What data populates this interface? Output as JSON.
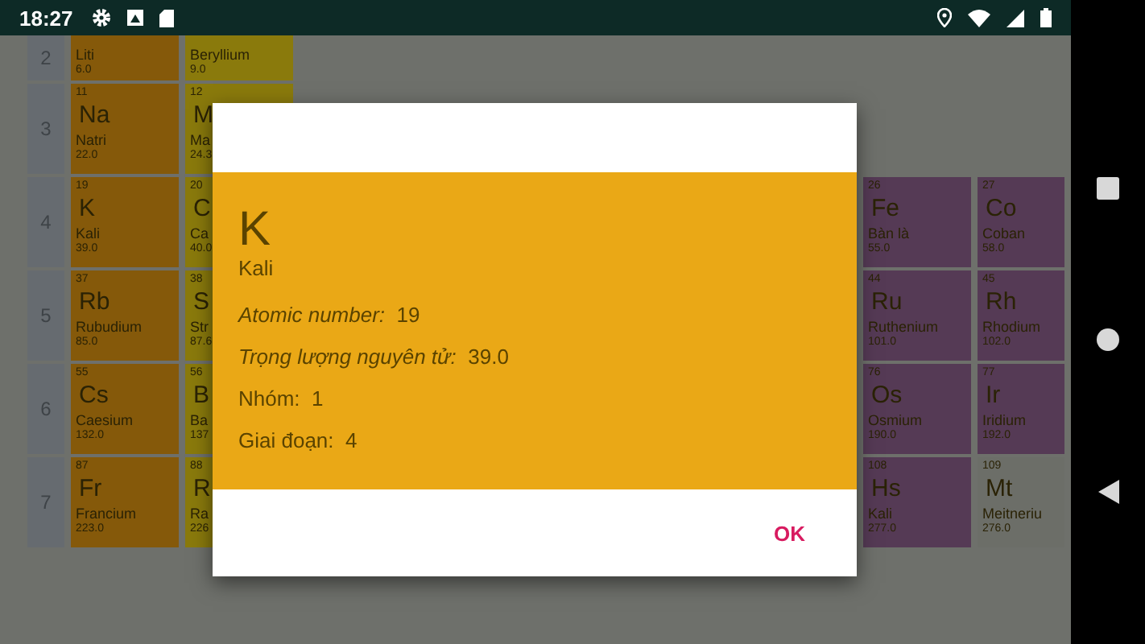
{
  "status_bar": {
    "time": "18:27"
  },
  "periodic_table": {
    "rows": [
      {
        "period": "2",
        "left": [
          {
            "name": "Liti",
            "weight": "6.0",
            "color": "#85590a"
          },
          {
            "name": "Beryllium",
            "weight": "9.0",
            "color": "#8a7a0c"
          }
        ],
        "right": []
      },
      {
        "period": "3",
        "left": [
          {
            "number": "11",
            "symbol": "Na",
            "name": "Natri",
            "weight": "22.0",
            "color": "#85590a"
          },
          {
            "number": "12",
            "symbol": "M",
            "name": "Ma",
            "weight": "24.3",
            "color": "#8a7a0c"
          }
        ],
        "right": []
      },
      {
        "period": "4",
        "left": [
          {
            "number": "19",
            "symbol": "K",
            "name": "Kali",
            "weight": "39.0",
            "color": "#85590a"
          },
          {
            "number": "20",
            "symbol": "C",
            "name": "Ca",
            "weight": "40.0",
            "color": "#8a7a0c"
          }
        ],
        "right": [
          {
            "number": "26",
            "symbol": "Fe",
            "name": "Bàn là",
            "weight": "55.0",
            "color": "#553a55"
          },
          {
            "number": "27",
            "symbol": "Co",
            "name": "Coban",
            "weight": "58.0",
            "color": "#553a55"
          }
        ]
      },
      {
        "period": "5",
        "left": [
          {
            "number": "37",
            "symbol": "Rb",
            "name": "Rubudium",
            "weight": "85.0",
            "color": "#85590a"
          },
          {
            "number": "38",
            "symbol": "S",
            "name": "Str",
            "weight": "87.6",
            "color": "#8a7a0c"
          }
        ],
        "right": [
          {
            "number": "44",
            "symbol": "Ru",
            "name": "Ruthenium",
            "weight": "101.0",
            "color": "#553a55"
          },
          {
            "number": "45",
            "symbol": "Rh",
            "name": "Rhodium",
            "weight": "102.0",
            "color": "#553a55"
          }
        ]
      },
      {
        "period": "6",
        "left": [
          {
            "number": "55",
            "symbol": "Cs",
            "name": "Caesium",
            "weight": "132.0",
            "color": "#85590a"
          },
          {
            "number": "56",
            "symbol": "B",
            "name": "Ba",
            "weight": "137",
            "color": "#8a7a0c"
          }
        ],
        "right": [
          {
            "number": "76",
            "symbol": "Os",
            "name": "Osmium",
            "weight": "190.0",
            "color": "#553a55"
          },
          {
            "number": "77",
            "symbol": "Ir",
            "name": "Iridium",
            "weight": "192.0",
            "color": "#553a55"
          }
        ]
      },
      {
        "period": "7",
        "left": [
          {
            "number": "87",
            "symbol": "Fr",
            "name": "Francium",
            "weight": "223.0",
            "color": "#85590a"
          },
          {
            "number": "88",
            "symbol": "R",
            "name": "Ra",
            "weight": "226",
            "color": "#8a7a0c"
          }
        ],
        "right": [
          {
            "number": "108",
            "symbol": "Hs",
            "name": "Kali",
            "weight": "277.0",
            "color": "#553a55"
          },
          {
            "number": "109",
            "symbol": "Mt",
            "name": "Meitneriu",
            "weight": "276.0",
            "color": "#6c6e68"
          }
        ]
      }
    ]
  },
  "dialog": {
    "color": "#eaa816",
    "symbol": "K",
    "name": "Kali",
    "facts": [
      {
        "label": "Atomic number:",
        "value": "19",
        "italic": true
      },
      {
        "label": "Trọng lượng nguyên tử:",
        "value": "39.0",
        "italic": true
      },
      {
        "label": "Nhóm:",
        "value": "1",
        "italic": false
      },
      {
        "label": "Giai đoạn:",
        "value": "4",
        "italic": false
      }
    ],
    "button": "OK"
  }
}
